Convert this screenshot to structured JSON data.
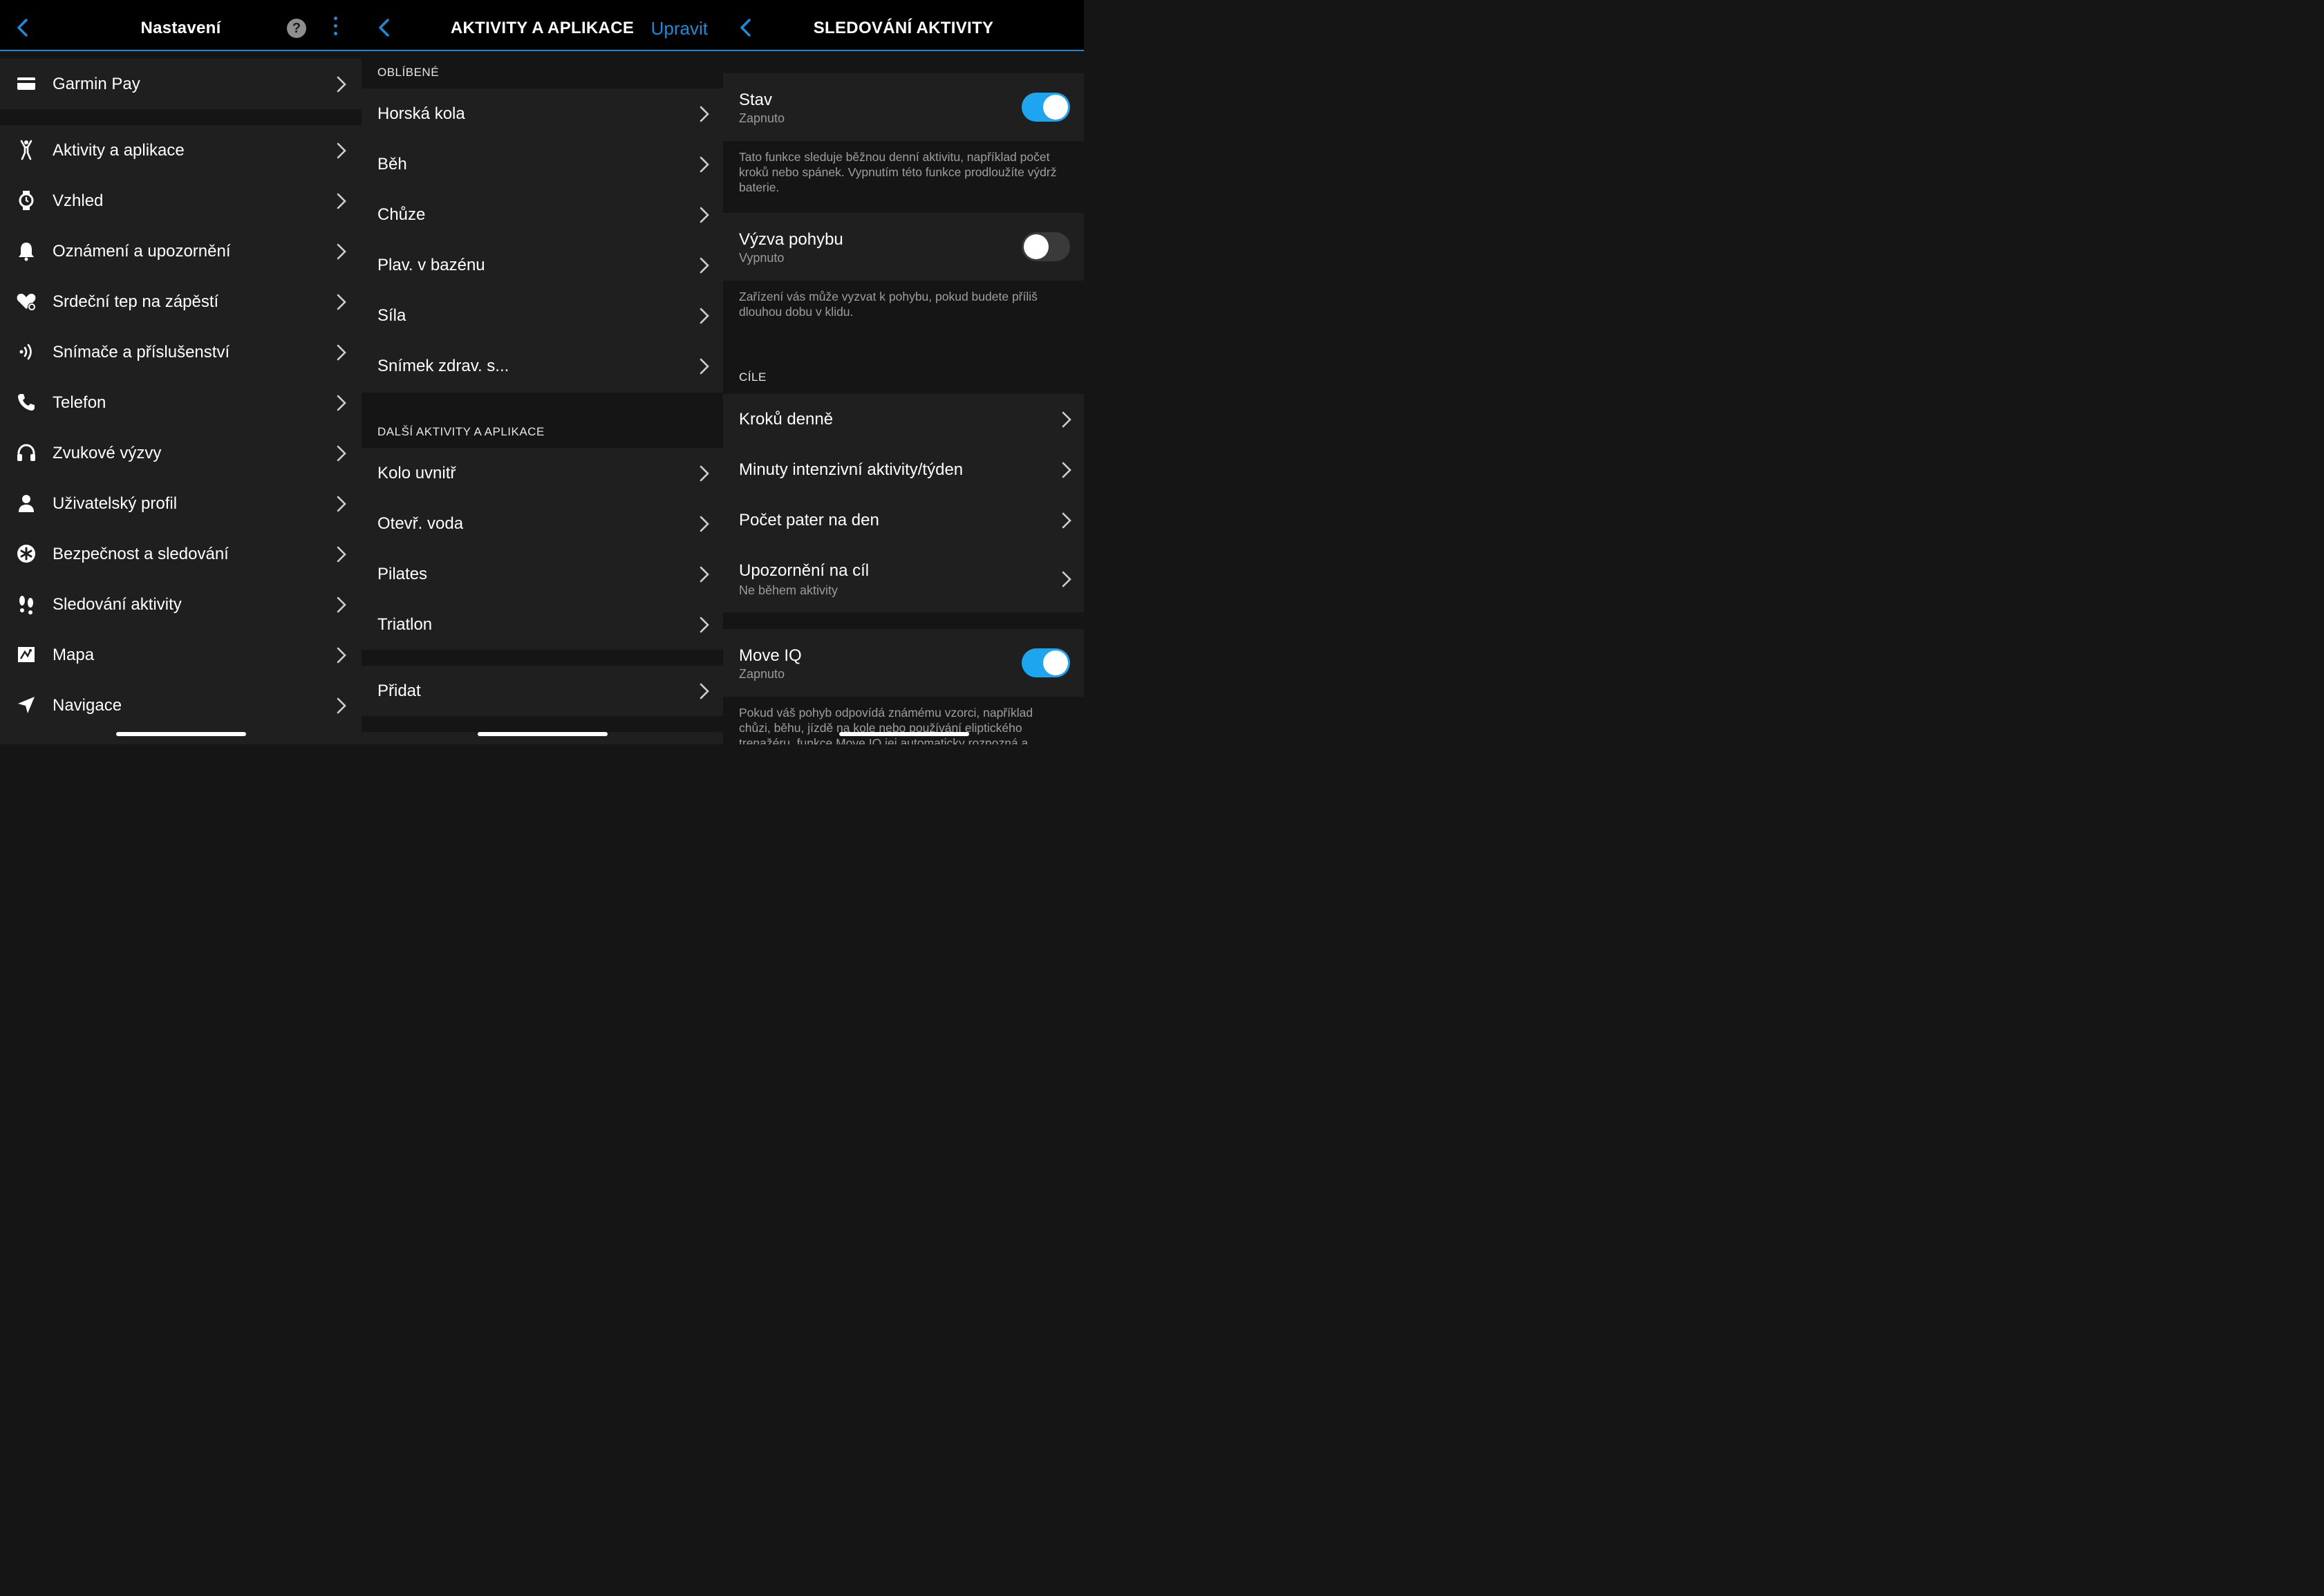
{
  "settings": {
    "title": "Nastavení",
    "help_glyph": "?",
    "items": [
      {
        "label": "Garmin Pay",
        "icon": "card-icon"
      },
      {
        "label": "Aktivity a aplikace",
        "icon": "activity-person-icon"
      },
      {
        "label": "Vzhled",
        "icon": "watch-icon"
      },
      {
        "label": "Oznámení a upozornění",
        "icon": "bell-icon"
      },
      {
        "label": "Srdeční tep na zápěstí",
        "icon": "heart-gear-icon"
      },
      {
        "label": "Snímače a příslušenství",
        "icon": "sensor-waves-icon"
      },
      {
        "label": "Telefon",
        "icon": "phone-icon"
      },
      {
        "label": "Zvukové výzvy",
        "icon": "headphones-icon"
      },
      {
        "label": "Uživatelský profil",
        "icon": "user-icon"
      },
      {
        "label": "Bezpečnost a sledování",
        "icon": "safety-asterisk-icon"
      },
      {
        "label": "Sledování aktivity",
        "icon": "footprints-icon"
      },
      {
        "label": "Mapa",
        "icon": "map-icon"
      },
      {
        "label": "Navigace",
        "icon": "navigation-arrow-icon"
      }
    ]
  },
  "activities": {
    "title": "AKTIVITY A APLIKACE",
    "edit_label": "Upravit",
    "favorites_label": "OBLÍBENÉ",
    "favorites": [
      "Horská kola",
      "Běh",
      "Chůze",
      "Plav. v bazénu",
      "Síla",
      "Snímek zdrav. s..."
    ],
    "more_label": "DALŠÍ AKTIVITY A APLIKACE",
    "more": [
      "Kolo uvnitř",
      "Otevř. voda",
      "Pilates",
      "Triatlon"
    ],
    "add_label": "Přidat"
  },
  "tracking": {
    "title": "SLEDOVÁNÍ AKTIVITY",
    "status": {
      "label": "Stav",
      "value": "Zapnuto",
      "on": true
    },
    "status_desc": "Tato funkce sleduje běžnou denní aktivitu, například počet kroků nebo spánek. Vypnutím této funkce prodloužíte výdrž baterie.",
    "move_alert": {
      "label": "Výzva pohybu",
      "value": "Vypnuto",
      "on": false
    },
    "move_alert_desc": "Zařízení vás může vyzvat k pohybu, pokud budete příliš dlouhou dobu v klidu.",
    "goals_label": "CÍLE",
    "goals": [
      {
        "label": "Kroků denně"
      },
      {
        "label": "Minuty intenzivní aktivity/týden"
      },
      {
        "label": "Počet pater na den"
      },
      {
        "label": "Upozornění na cíl",
        "sub": "Ne během aktivity"
      }
    ],
    "move_iq": {
      "label": "Move IQ",
      "value": "Zapnuto",
      "on": true
    },
    "move_iq_desc": "Pokud váš pohyb odpovídá známému vzorci, například chůzi, běhu, jízdě na kole nebo používání eliptického trenažéru, funkce Move IQ jej automaticky rozpozná a"
  },
  "colors": {
    "accent": "#1f8bd6",
    "toggle_on": "#1ea5f0",
    "row_bg": "#1f1f1f",
    "page_bg": "#151515"
  }
}
